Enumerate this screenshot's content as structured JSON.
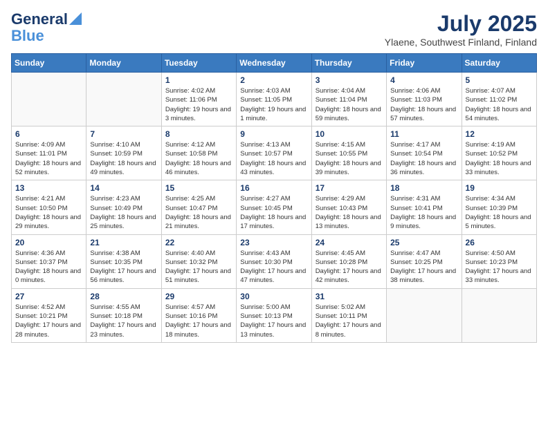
{
  "logo": {
    "line1": "General",
    "line2": "Blue"
  },
  "title": "July 2025",
  "subtitle": "Ylaene, Southwest Finland, Finland",
  "days_of_week": [
    "Sunday",
    "Monday",
    "Tuesday",
    "Wednesday",
    "Thursday",
    "Friday",
    "Saturday"
  ],
  "weeks": [
    [
      {
        "day": "",
        "sunrise": "",
        "sunset": "",
        "daylight": ""
      },
      {
        "day": "",
        "sunrise": "",
        "sunset": "",
        "daylight": ""
      },
      {
        "day": "1",
        "sunrise": "Sunrise: 4:02 AM",
        "sunset": "Sunset: 11:06 PM",
        "daylight": "Daylight: 19 hours and 3 minutes."
      },
      {
        "day": "2",
        "sunrise": "Sunrise: 4:03 AM",
        "sunset": "Sunset: 11:05 PM",
        "daylight": "Daylight: 19 hours and 1 minute."
      },
      {
        "day": "3",
        "sunrise": "Sunrise: 4:04 AM",
        "sunset": "Sunset: 11:04 PM",
        "daylight": "Daylight: 18 hours and 59 minutes."
      },
      {
        "day": "4",
        "sunrise": "Sunrise: 4:06 AM",
        "sunset": "Sunset: 11:03 PM",
        "daylight": "Daylight: 18 hours and 57 minutes."
      },
      {
        "day": "5",
        "sunrise": "Sunrise: 4:07 AM",
        "sunset": "Sunset: 11:02 PM",
        "daylight": "Daylight: 18 hours and 54 minutes."
      }
    ],
    [
      {
        "day": "6",
        "sunrise": "Sunrise: 4:09 AM",
        "sunset": "Sunset: 11:01 PM",
        "daylight": "Daylight: 18 hours and 52 minutes."
      },
      {
        "day": "7",
        "sunrise": "Sunrise: 4:10 AM",
        "sunset": "Sunset: 10:59 PM",
        "daylight": "Daylight: 18 hours and 49 minutes."
      },
      {
        "day": "8",
        "sunrise": "Sunrise: 4:12 AM",
        "sunset": "Sunset: 10:58 PM",
        "daylight": "Daylight: 18 hours and 46 minutes."
      },
      {
        "day": "9",
        "sunrise": "Sunrise: 4:13 AM",
        "sunset": "Sunset: 10:57 PM",
        "daylight": "Daylight: 18 hours and 43 minutes."
      },
      {
        "day": "10",
        "sunrise": "Sunrise: 4:15 AM",
        "sunset": "Sunset: 10:55 PM",
        "daylight": "Daylight: 18 hours and 39 minutes."
      },
      {
        "day": "11",
        "sunrise": "Sunrise: 4:17 AM",
        "sunset": "Sunset: 10:54 PM",
        "daylight": "Daylight: 18 hours and 36 minutes."
      },
      {
        "day": "12",
        "sunrise": "Sunrise: 4:19 AM",
        "sunset": "Sunset: 10:52 PM",
        "daylight": "Daylight: 18 hours and 33 minutes."
      }
    ],
    [
      {
        "day": "13",
        "sunrise": "Sunrise: 4:21 AM",
        "sunset": "Sunset: 10:50 PM",
        "daylight": "Daylight: 18 hours and 29 minutes."
      },
      {
        "day": "14",
        "sunrise": "Sunrise: 4:23 AM",
        "sunset": "Sunset: 10:49 PM",
        "daylight": "Daylight: 18 hours and 25 minutes."
      },
      {
        "day": "15",
        "sunrise": "Sunrise: 4:25 AM",
        "sunset": "Sunset: 10:47 PM",
        "daylight": "Daylight: 18 hours and 21 minutes."
      },
      {
        "day": "16",
        "sunrise": "Sunrise: 4:27 AM",
        "sunset": "Sunset: 10:45 PM",
        "daylight": "Daylight: 18 hours and 17 minutes."
      },
      {
        "day": "17",
        "sunrise": "Sunrise: 4:29 AM",
        "sunset": "Sunset: 10:43 PM",
        "daylight": "Daylight: 18 hours and 13 minutes."
      },
      {
        "day": "18",
        "sunrise": "Sunrise: 4:31 AM",
        "sunset": "Sunset: 10:41 PM",
        "daylight": "Daylight: 18 hours and 9 minutes."
      },
      {
        "day": "19",
        "sunrise": "Sunrise: 4:34 AM",
        "sunset": "Sunset: 10:39 PM",
        "daylight": "Daylight: 18 hours and 5 minutes."
      }
    ],
    [
      {
        "day": "20",
        "sunrise": "Sunrise: 4:36 AM",
        "sunset": "Sunset: 10:37 PM",
        "daylight": "Daylight: 18 hours and 0 minutes."
      },
      {
        "day": "21",
        "sunrise": "Sunrise: 4:38 AM",
        "sunset": "Sunset: 10:35 PM",
        "daylight": "Daylight: 17 hours and 56 minutes."
      },
      {
        "day": "22",
        "sunrise": "Sunrise: 4:40 AM",
        "sunset": "Sunset: 10:32 PM",
        "daylight": "Daylight: 17 hours and 51 minutes."
      },
      {
        "day": "23",
        "sunrise": "Sunrise: 4:43 AM",
        "sunset": "Sunset: 10:30 PM",
        "daylight": "Daylight: 17 hours and 47 minutes."
      },
      {
        "day": "24",
        "sunrise": "Sunrise: 4:45 AM",
        "sunset": "Sunset: 10:28 PM",
        "daylight": "Daylight: 17 hours and 42 minutes."
      },
      {
        "day": "25",
        "sunrise": "Sunrise: 4:47 AM",
        "sunset": "Sunset: 10:25 PM",
        "daylight": "Daylight: 17 hours and 38 minutes."
      },
      {
        "day": "26",
        "sunrise": "Sunrise: 4:50 AM",
        "sunset": "Sunset: 10:23 PM",
        "daylight": "Daylight: 17 hours and 33 minutes."
      }
    ],
    [
      {
        "day": "27",
        "sunrise": "Sunrise: 4:52 AM",
        "sunset": "Sunset: 10:21 PM",
        "daylight": "Daylight: 17 hours and 28 minutes."
      },
      {
        "day": "28",
        "sunrise": "Sunrise: 4:55 AM",
        "sunset": "Sunset: 10:18 PM",
        "daylight": "Daylight: 17 hours and 23 minutes."
      },
      {
        "day": "29",
        "sunrise": "Sunrise: 4:57 AM",
        "sunset": "Sunset: 10:16 PM",
        "daylight": "Daylight: 17 hours and 18 minutes."
      },
      {
        "day": "30",
        "sunrise": "Sunrise: 5:00 AM",
        "sunset": "Sunset: 10:13 PM",
        "daylight": "Daylight: 17 hours and 13 minutes."
      },
      {
        "day": "31",
        "sunrise": "Sunrise: 5:02 AM",
        "sunset": "Sunset: 10:11 PM",
        "daylight": "Daylight: 17 hours and 8 minutes."
      },
      {
        "day": "",
        "sunrise": "",
        "sunset": "",
        "daylight": ""
      },
      {
        "day": "",
        "sunrise": "",
        "sunset": "",
        "daylight": ""
      }
    ]
  ]
}
